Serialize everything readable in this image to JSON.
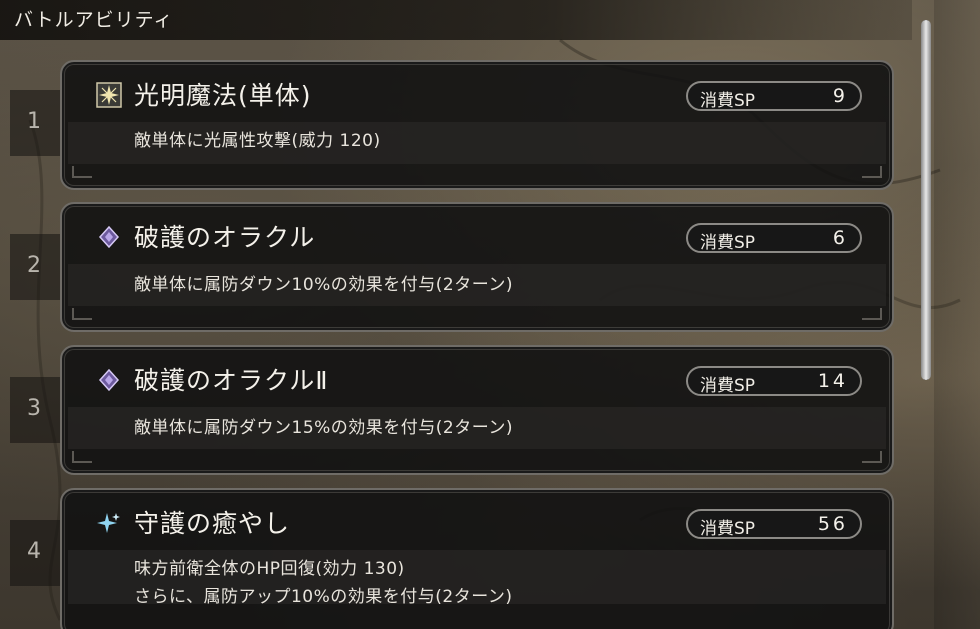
{
  "screen": {
    "title": "バトルアビリティ"
  },
  "abilities": [
    {
      "number": "1",
      "icon": "light-star-icon",
      "name": "光明魔法(単体)",
      "sp_label": "消費SP",
      "sp_cost": "9",
      "desc_line1": "敵単体に光属性攻撃(威力 120)",
      "desc_line2": ""
    },
    {
      "number": "2",
      "icon": "purple-diamond-icon",
      "name": "破護のオラクル",
      "sp_label": "消費SP",
      "sp_cost": "6",
      "desc_line1": "敵単体に属防ダウン10%の効果を付与(2ターン)",
      "desc_line2": ""
    },
    {
      "number": "3",
      "icon": "purple-diamond-icon",
      "name": "破護のオラクルⅡ",
      "sp_label": "消費SP",
      "sp_cost": "14",
      "desc_line1": "敵単体に属防ダウン15%の効果を付与(2ターン)",
      "desc_line2": ""
    },
    {
      "number": "4",
      "icon": "blue-sparkle-icon",
      "name": "守護の癒やし",
      "sp_label": "消費SP",
      "sp_cost": "56",
      "desc_line1": "味方前衛全体のHP回復(効力 130)",
      "desc_line2": "さらに、属防アップ10%の効果を付与(2ターン)"
    }
  ],
  "colors": {
    "card_bg": "#121212",
    "card_border": "#6f6c67",
    "text": "#f4f1ea",
    "purple_icon": "#b9a6e8",
    "blue_icon": "#8fd3f0",
    "gold_icon": "#f1e6b0"
  }
}
